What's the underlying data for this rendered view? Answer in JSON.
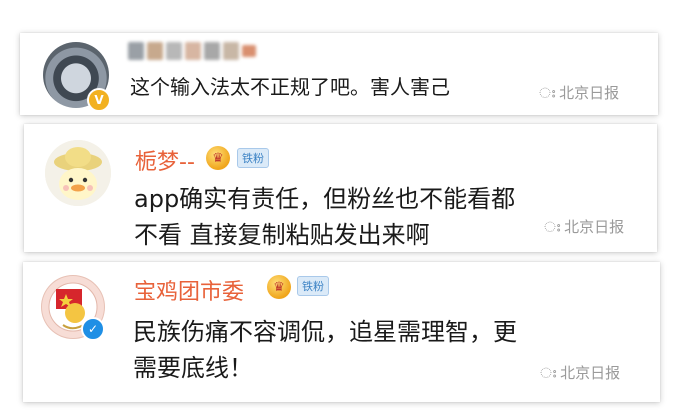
{
  "comments": [
    {
      "username": "",
      "text": "这个输入法太不正规了吧。害人害己",
      "avatar_badge_icon": "verified-gold-icon",
      "watermark": "北京日报"
    },
    {
      "username": "栀梦--",
      "user_level_icon": "crown-level-icon",
      "fan_badge": "铁粉",
      "text_lines": [
        "app确实有责任，但粉丝也不能看都",
        "不看 直接复制粘贴发出来啊"
      ],
      "watermark": "北京日报"
    },
    {
      "username": "宝鸡团市委",
      "user_level_icon": "crown-level-icon",
      "fan_badge": "铁粉",
      "avatar_badge_icon": "verified-blue-icon",
      "text_lines": [
        "民族伤痛不容调侃，追星需理智，更",
        "需要底线！"
      ],
      "watermark": "北京日报"
    }
  ],
  "colors": {
    "username": "#e8623a",
    "badge_text": "#3b82c4",
    "verified_blue": "#1f8fe5",
    "verified_gold": "#f2b120",
    "watermark": "#9a9a9a"
  }
}
